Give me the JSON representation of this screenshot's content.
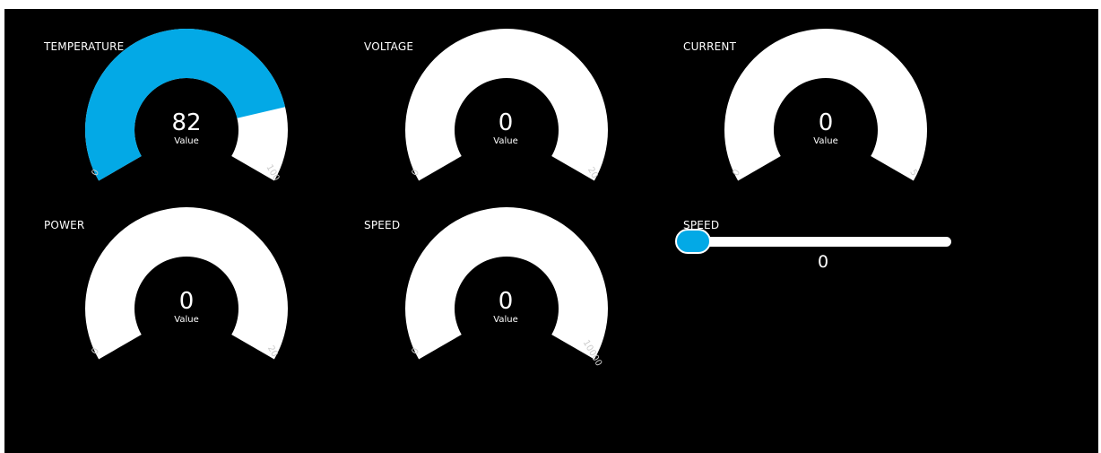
{
  "colors": {
    "background": "#000000",
    "gauge_track": "#ffffff",
    "gauge_fill": "#03a9e6"
  },
  "gauges": [
    {
      "label": "TEMPERATURE",
      "value": "82",
      "caption": "Value",
      "min": "0",
      "max": "100",
      "fraction": 0.82
    },
    {
      "label": "VOLTAGE",
      "value": "0",
      "caption": "Value",
      "min": "0",
      "max": "20",
      "fraction": 0
    },
    {
      "label": "CURRENT",
      "value": "0",
      "caption": "Value",
      "min": "0",
      "max": "5",
      "fraction": 0
    },
    {
      "label": "POWER",
      "value": "0",
      "caption": "Value",
      "min": "0",
      "max": "20",
      "fraction": 0
    },
    {
      "label": "SPEED",
      "value": "0",
      "caption": "Value",
      "min": "0",
      "max": "10000",
      "fraction": 0
    }
  ],
  "slider": {
    "label": "SPEED",
    "value": "0",
    "fraction": 0
  }
}
